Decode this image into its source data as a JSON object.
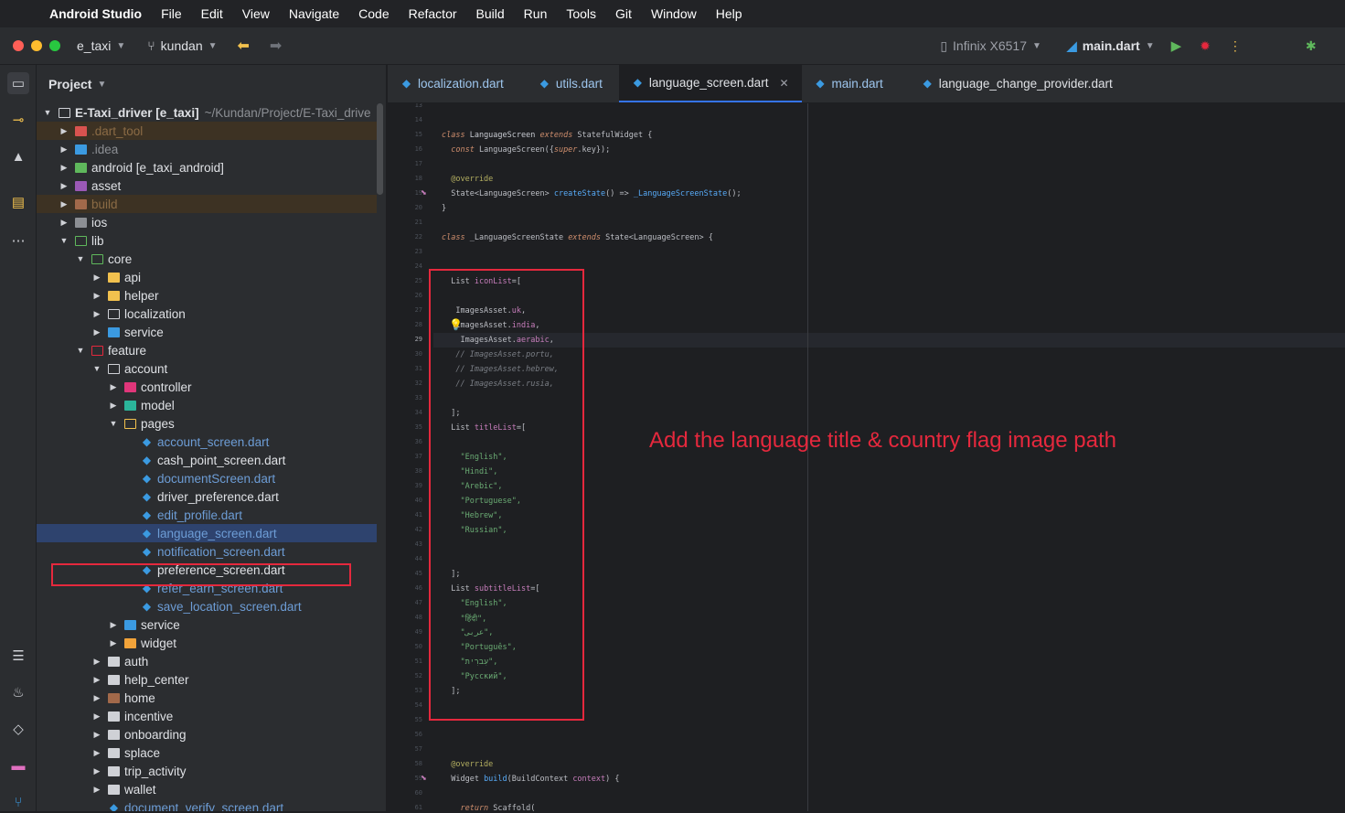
{
  "menubar": {
    "app": "Android Studio",
    "items": [
      "File",
      "Edit",
      "View",
      "Navigate",
      "Code",
      "Refactor",
      "Build",
      "Run",
      "Tools",
      "Git",
      "Window",
      "Help"
    ]
  },
  "toolbar": {
    "project": "e_taxi",
    "branch": "kundan",
    "device": "Infinix X6517",
    "run_config": "main.dart"
  },
  "project_panel": {
    "title": "Project",
    "root_name": "E-Taxi_driver [e_taxi]",
    "root_path": "~/Kundan/Project/E-Taxi_drive",
    "rows": [
      ".dart_tool",
      ".idea",
      "android [e_taxi_android]",
      "asset",
      "build",
      "ios",
      "lib",
      "core",
      "api",
      "helper",
      "localization",
      "service",
      "feature",
      "account",
      "controller",
      "model",
      "pages",
      "account_screen.dart",
      "cash_point_screen.dart",
      "documentScreen.dart",
      "driver_preference.dart",
      "edit_profile.dart",
      "language_screen.dart",
      "notification_screen.dart",
      "preference_screen.dart",
      "refer_earn_screen.dart",
      "save_location_screen.dart",
      "service",
      "widget",
      "auth",
      "help_center",
      "home",
      "incentive",
      "onboarding",
      "splace",
      "trip_activity",
      "wallet",
      "document_verify_screen.dart"
    ]
  },
  "tabs": [
    {
      "label": "localization.dart",
      "active": false
    },
    {
      "label": "utils.dart",
      "active": false
    },
    {
      "label": "language_screen.dart",
      "active": true
    },
    {
      "label": "main.dart",
      "active": false
    },
    {
      "label": "language_change_provider.dart",
      "active": false
    }
  ],
  "editor": {
    "line_numbers": [
      "13",
      "14",
      "15",
      "16",
      "17",
      "18",
      "19",
      "20",
      "21",
      "22",
      "23",
      "24",
      "25",
      "26",
      "27",
      "28",
      "29",
      "30",
      "31",
      "32",
      "33",
      "34",
      "35",
      "36",
      "37",
      "38",
      "39",
      "40",
      "41",
      "42",
      "43",
      "44",
      "45",
      "46",
      "47",
      "48",
      "49",
      "50",
      "51",
      "52",
      "53",
      "54",
      "55",
      "56",
      "57",
      "58",
      "59",
      "60",
      "61"
    ],
    "current_line": "29",
    "code": {
      "l15a": "class",
      "l15b": " LanguageScreen ",
      "l15c": "extends",
      "l15d": " StatefulWidget {",
      "l16a": "  const",
      "l16b": " LanguageScreen({",
      "l16c": "super",
      "l16d": ".key});",
      "l18": "  @override",
      "l19a": "  State<LanguageScreen> ",
      "l19b": "createState",
      "l19c": "() => ",
      "l19d": "_LanguageScreenState",
      "l19e": "();",
      "l20": "}",
      "l22a": "class",
      "l22b": " _LanguageScreenState ",
      "l22c": "extends",
      "l22d": " State<LanguageScreen> {",
      "l25a": "  List ",
      "l25b": "iconList",
      "l25c": "=[",
      "l27a": "   ImagesAsset.",
      "l27b": "uk",
      "l27c": ",",
      "l28a": "   ImagesAsset.",
      "l28b": "india",
      "l28c": ",",
      "l29a": "    ImagesAsset.",
      "l29b": "aerabic",
      "l29c": ",",
      "l30": "   // ImagesAsset.portu,",
      "l31": "   // ImagesAsset.hebrew,",
      "l32": "   // ImagesAsset.rusia,",
      "l34": "  ];",
      "l35a": "  List ",
      "l35b": "titleList",
      "l35c": "=[",
      "l37": "    \"English\",",
      "l38": "    \"Hindi\",",
      "l39": "    \"Arebic\",",
      "l40": "    \"Portuguese\",",
      "l41": "    \"Hebrew\",",
      "l42": "    \"Russian\",",
      "l45": "  ];",
      "l46a": "  List ",
      "l46b": "subtitleList",
      "l46c": "=[",
      "l47": "    \"English\",",
      "l48": "    \"हिंदी\",",
      "l49": "    \"عربى\",",
      "l50": "    \"Português\",",
      "l51": "    \"עִברִית\",",
      "l52": "    \"Русский\",",
      "l53": "  ];",
      "l58": "  @override",
      "l59a": "  Widget ",
      "l59b": "build",
      "l59c": "(BuildContext ",
      "l59d": "context",
      "l59e": ") {",
      "l61a": "    return",
      "l61b": " Scaffold("
    }
  },
  "annotation": "Add the language title & country flag image path",
  "colors": {
    "annotation": "#e5283d",
    "accent": "#3574f0",
    "dart": "#3b9ae1"
  }
}
